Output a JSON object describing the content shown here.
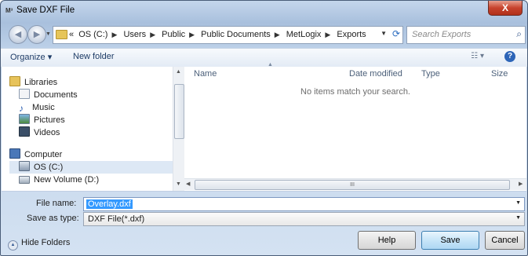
{
  "window": {
    "title": "Save DXF File",
    "app_icon": "M³",
    "close_label": "X"
  },
  "address": {
    "crumbs": [
      "OS (C:)",
      "Users",
      "Public",
      "Public Documents",
      "MetLogix",
      "Exports"
    ],
    "overflow": "«",
    "search_placeholder": "Search Exports"
  },
  "toolbar": {
    "organize": "Organize ▾",
    "new_folder": "New folder"
  },
  "nav": {
    "libraries": "Libraries",
    "documents": "Documents",
    "music": "Music",
    "pictures": "Pictures",
    "videos": "Videos",
    "computer": "Computer",
    "os_drive": "OS (C:)",
    "new_volume": "New Volume (D:)"
  },
  "list": {
    "columns": [
      "Name",
      "Date modified",
      "Type",
      "Size"
    ],
    "empty_message": "No items match your search.",
    "hscroll_grip": "III"
  },
  "form": {
    "file_name_label": "File name:",
    "file_name_value": "Overlay.dxf",
    "save_as_type_label": "Save as type:",
    "save_as_type_value": "DXF File(*.dxf)"
  },
  "footer": {
    "hide_folders": "Hide Folders",
    "help": "Help",
    "save": "Save",
    "cancel": "Cancel"
  },
  "colors": {
    "frame": "#a9c0dd",
    "selection": "#3399ff",
    "primary_button": "#c7e5f8"
  }
}
